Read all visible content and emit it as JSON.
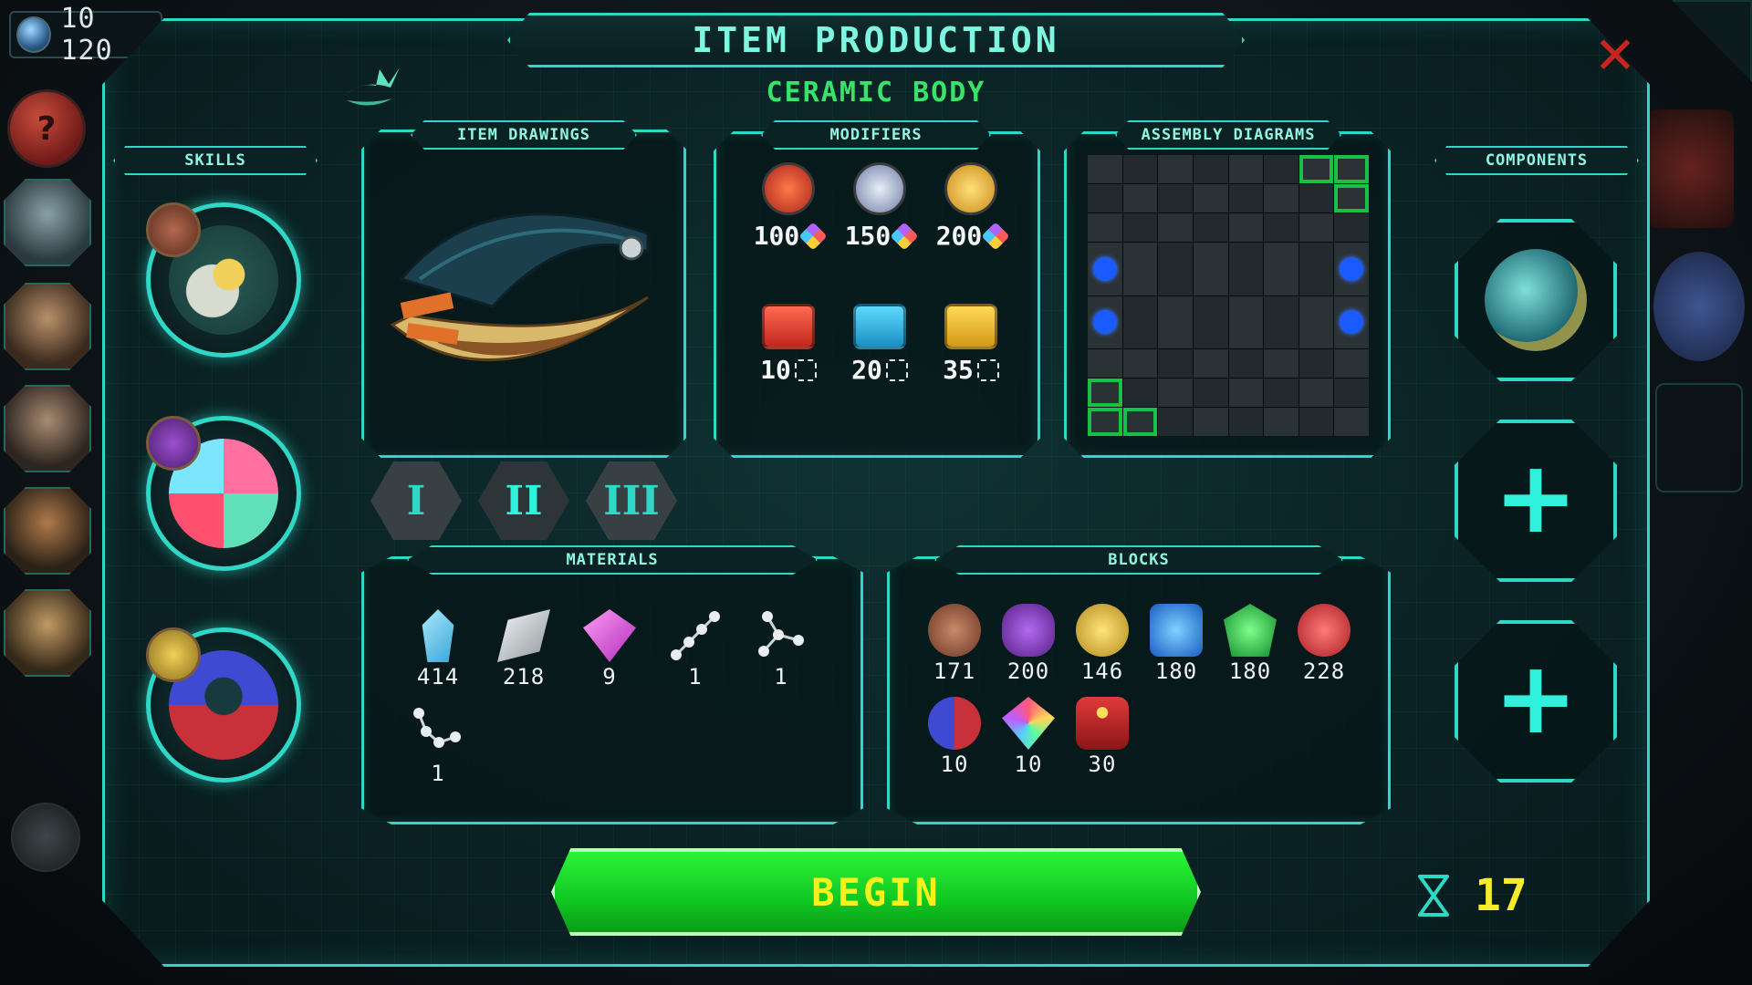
{
  "hud": {
    "currency": "10 120"
  },
  "header": {
    "title": "ITEM PRODUCTION",
    "subtitle": "CERAMIC BODY",
    "close": "✕"
  },
  "sections": {
    "skills": "SKILLS",
    "item_drawings": "ITEM DRAWINGS",
    "modifiers": "MODIFIERS",
    "assembly": "ASSEMBLY DIAGRAMS",
    "components": "COMPONENTS",
    "materials": "MATERIALS",
    "blocks": "BLOCKS"
  },
  "tiers": [
    "I",
    "II",
    "III"
  ],
  "modifiers": [
    {
      "icon": "tier-1-gear-icon",
      "value": "100",
      "cost": "cube"
    },
    {
      "icon": "tier-2-gear-icon",
      "value": "150",
      "cost": "cube"
    },
    {
      "icon": "tier-3-gear-icon",
      "value": "200",
      "cost": "cube"
    },
    {
      "icon": "red-circuit-chip-icon",
      "value": "10",
      "cost": "fragment"
    },
    {
      "icon": "blue-circuit-chip-icon",
      "value": "20",
      "cost": "fragment"
    },
    {
      "icon": "gold-circuit-chip-icon",
      "value": "35",
      "cost": "fragment"
    }
  ],
  "materials": [
    {
      "icon": "blue-crystal-icon",
      "value": "414"
    },
    {
      "icon": "silver-ingot-icon",
      "value": "218"
    },
    {
      "icon": "pink-gem-icon",
      "value": "9"
    },
    {
      "icon": "linear-molecule-icon",
      "value": "1"
    },
    {
      "icon": "branched-molecule-icon",
      "value": "1"
    },
    {
      "icon": "chain-molecule-icon",
      "value": "1"
    }
  ],
  "blocks": [
    {
      "icon": "rusty-gear-block-icon",
      "value": "171"
    },
    {
      "icon": "purple-ore-block-icon",
      "value": "200"
    },
    {
      "icon": "yellow-ore-block-icon",
      "value": "146"
    },
    {
      "icon": "blue-crystal-block-icon",
      "value": "180"
    },
    {
      "icon": "green-crystal-block-icon",
      "value": "180"
    },
    {
      "icon": "red-stamp-block-icon",
      "value": "228"
    },
    {
      "icon": "magnet-block-icon",
      "value": "10"
    },
    {
      "icon": "rainbow-gem-block-icon",
      "value": "10"
    },
    {
      "icon": "dynamite-block-icon",
      "value": "30"
    }
  ],
  "actions": {
    "begin": "BEGIN"
  },
  "timer": {
    "value": "17"
  },
  "colors": {
    "accent": "#2fd7c6",
    "title": "#7ff6df",
    "subtitle": "#39e36a",
    "begin": "#11c722",
    "begin_text": "#f4f21c",
    "timer": "#f4ec2c",
    "close": "#c9241d"
  }
}
